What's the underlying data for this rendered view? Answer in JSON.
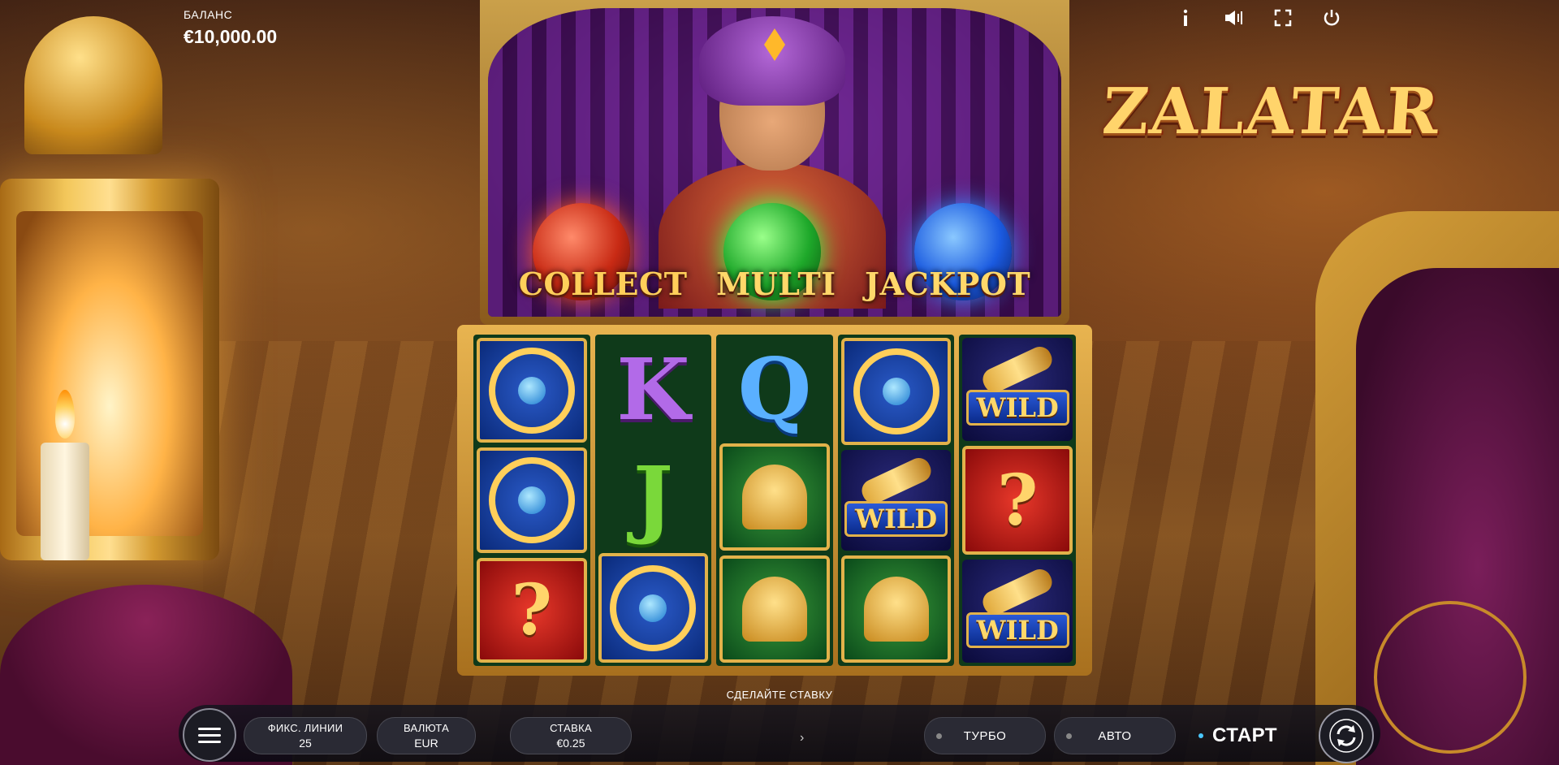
{
  "header": {
    "balance_label": "БАЛАНС",
    "balance_value": "€10,000.00",
    "icons": [
      "info-icon",
      "sound-icon",
      "fullscreen-icon",
      "power-icon"
    ]
  },
  "logo": {
    "text": "ZALATAR"
  },
  "feature_banner": {
    "labels": [
      "COLLECT",
      "MULTI",
      "JACKPOT"
    ],
    "orb_colors": [
      "#e8382a",
      "#2ac83a",
      "#2a6ae8"
    ]
  },
  "reels": [
    [
      "wheel",
      "wheel",
      "question"
    ],
    [
      "K",
      "J",
      "wheel"
    ],
    [
      "Q",
      "tree",
      "tree"
    ],
    [
      "wheel",
      "wild",
      "tree"
    ],
    [
      "wild",
      "question",
      "wild"
    ]
  ],
  "symbols": {
    "wild_text": "WILD",
    "question_text": "?"
  },
  "bottom_bar": {
    "prompt": "СДЕЛАЙТЕ СТАВКУ",
    "lines_label": "ФИКС. ЛИНИИ",
    "lines_value": "25",
    "currency_label": "ВАЛЮТА",
    "currency_value": "EUR",
    "bet_label": "СТАВКА",
    "bet_value": "€0.25",
    "turbo_label": "ТУРБО",
    "auto_label": "АВТО",
    "start_label": "СТАРТ"
  },
  "colors": {
    "accent_gold": "#e2b24a",
    "panel_bg": "#1c1c24"
  }
}
